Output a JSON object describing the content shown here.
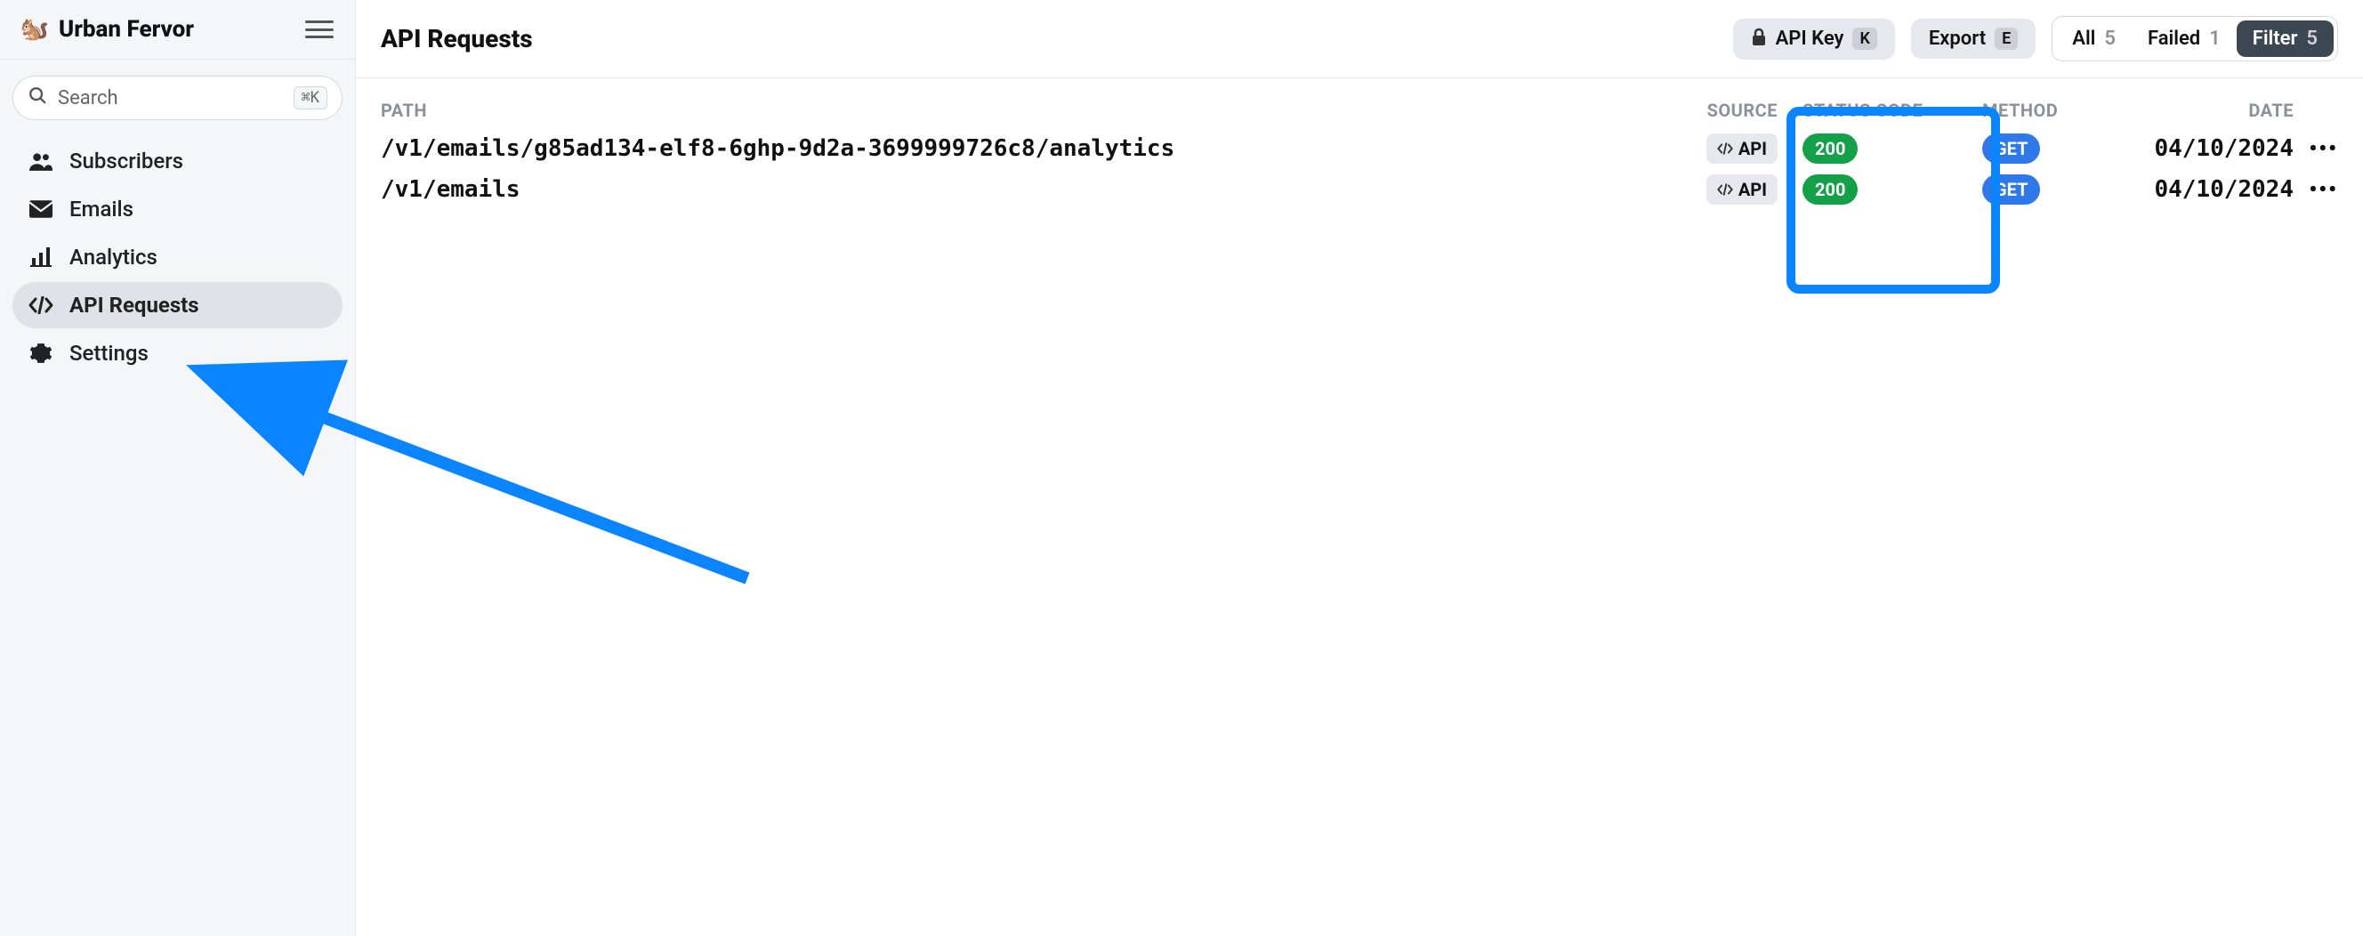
{
  "brand": {
    "name": "Urban Fervor",
    "logo_emoji": "🐿️"
  },
  "search": {
    "placeholder": "Search",
    "shortcut": "⌘K"
  },
  "sidebar": {
    "items": [
      {
        "label": "Subscribers",
        "icon": "users-icon",
        "active": false
      },
      {
        "label": "Emails",
        "icon": "envelope-icon",
        "active": false
      },
      {
        "label": "Analytics",
        "icon": "chart-icon",
        "active": false
      },
      {
        "label": "API Requests",
        "icon": "code-icon",
        "active": true
      },
      {
        "label": "Settings",
        "icon": "gear-icon",
        "active": false
      }
    ]
  },
  "header": {
    "title": "API Requests",
    "api_key_btn": {
      "label": "API Key",
      "shortcut": "K"
    },
    "export_btn": {
      "label": "Export",
      "shortcut": "E"
    },
    "tabs": [
      {
        "label": "All",
        "count": "5",
        "selected": false
      },
      {
        "label": "Failed",
        "count": "1",
        "selected": false
      },
      {
        "label": "Filter",
        "count": "5",
        "selected": true
      }
    ]
  },
  "table": {
    "columns": {
      "path": "PATH",
      "source": "SOURCE",
      "status": "STATUS CODE",
      "method": "METHOD",
      "date": "DATE"
    },
    "rows": [
      {
        "path": "/v1/emails/g85ad134-elf8-6ghp-9d2a-3699999726c8/analytics",
        "source": "API",
        "status": "200",
        "method": "GET",
        "date": "04/10/2024"
      },
      {
        "path": "/v1/emails",
        "source": "API",
        "status": "200",
        "method": "GET",
        "date": "04/10/2024"
      }
    ]
  },
  "annotations": {
    "arrow_to": "sidebar-item-api-requests",
    "highlight_column": "status_code"
  }
}
